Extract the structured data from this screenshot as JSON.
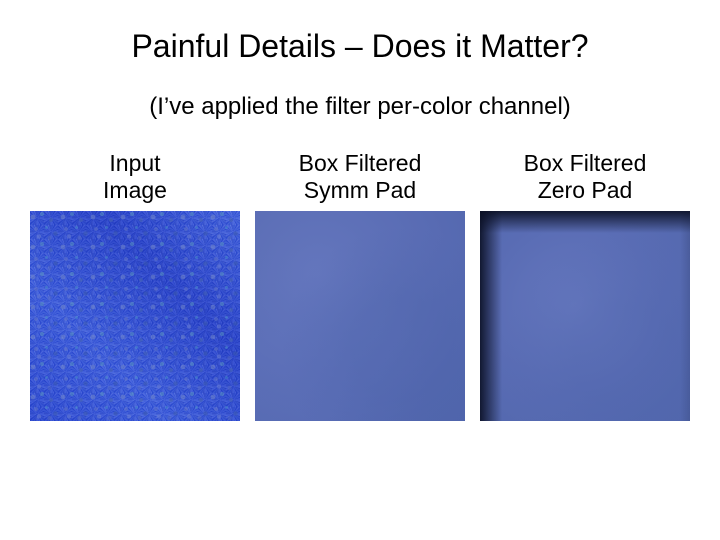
{
  "title": "Painful Details – Does it Matter?",
  "subtitle": "(I’ve applied the filter per-color channel)",
  "panels": [
    {
      "label": "Input\nImage"
    },
    {
      "label": "Box Filtered\nSymm Pad"
    },
    {
      "label": "Box Filtered\nZero Pad"
    }
  ]
}
